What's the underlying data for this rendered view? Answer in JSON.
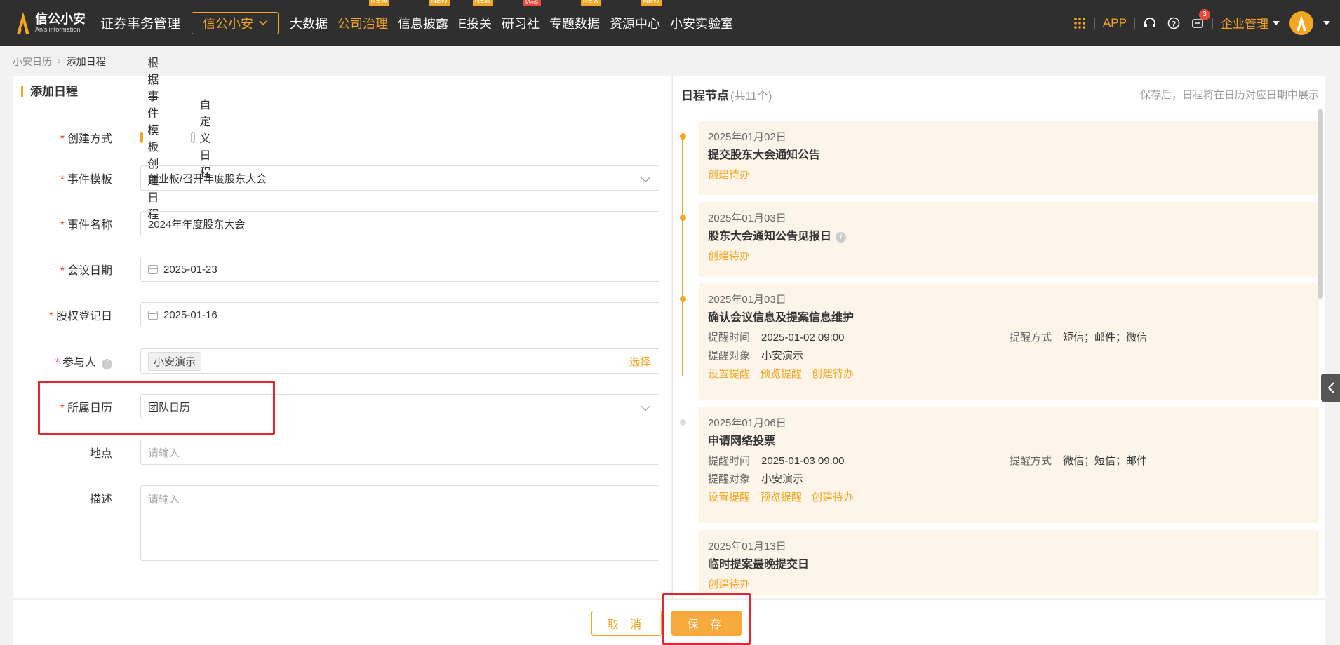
{
  "header": {
    "logo_cn": "信公小安",
    "logo_en": "An's information",
    "system_title": "证券事务管理",
    "brand_select": "信公小安",
    "nav": [
      {
        "label": "大数据",
        "badge": ""
      },
      {
        "label": "公司治理",
        "badge": "NEW"
      },
      {
        "label": "信息披露",
        "badge": "NEW"
      },
      {
        "label": "E投关",
        "badge": "NEW"
      },
      {
        "label": "研习社",
        "badge": "优惠"
      },
      {
        "label": "专题数据",
        "badge": "NEW"
      },
      {
        "label": "资源中心",
        "badge": "NEW"
      },
      {
        "label": "小安实验室",
        "badge": ""
      }
    ],
    "app_label": "APP",
    "message_count": "3",
    "corp_menu": "企业管理"
  },
  "breadcrumb": {
    "parent": "小安日历",
    "current": "添加日程"
  },
  "form": {
    "title": "添加日程",
    "create_mode": {
      "label": "创建方式",
      "options": [
        "根据事件模板创建日程",
        "自定义日程"
      ],
      "selected": "根据事件模板创建日程"
    },
    "template": {
      "label": "事件模板",
      "value": "创业板/召开年度股东大会"
    },
    "event_name": {
      "label": "事件名称",
      "value": "2024年年度股东大会"
    },
    "meeting_date": {
      "label": "会议日期",
      "value": "2025-01-23"
    },
    "record_date": {
      "label": "股权登记日",
      "value": "2025-01-16"
    },
    "participants": {
      "label": "参与人",
      "tag": "小安演示",
      "select_link": "选择"
    },
    "calendar": {
      "label": "所属日历",
      "value": "团队日历"
    },
    "location": {
      "label": "地点",
      "placeholder": "请输入"
    },
    "description": {
      "label": "描述",
      "placeholder": "请输入"
    }
  },
  "schedule": {
    "title": "日程节点",
    "count": "(共11个)",
    "hint": "保存后，日程将在日历对应日期中展示",
    "nodes": [
      {
        "date": "2025年01月02日",
        "name": "提交股东大会通知公告",
        "actions": [
          "创建待办"
        ]
      },
      {
        "date": "2025年01月03日",
        "name": "股东大会通知公告见报日",
        "actions": [
          "创建待办"
        ]
      },
      {
        "date": "2025年01月03日",
        "name": "确认会议信息及提案信息维护",
        "remind_time_label": "提醒时间",
        "remind_time": "2025-01-02 09:00",
        "remind_method_label": "提醒方式",
        "remind_method": "短信；邮件；微信",
        "remind_target_label": "提醒对象",
        "remind_target": "小安演示",
        "actions": [
          "设置提醒",
          "预览提醒",
          "创建待办"
        ]
      },
      {
        "date": "2025年01月06日",
        "name": "申请网络投票",
        "remind_time_label": "提醒时间",
        "remind_time": "2025-01-03 09:00",
        "remind_method_label": "提醒方式",
        "remind_method": "微信；短信；邮件",
        "remind_target_label": "提醒对象",
        "remind_target": "小安演示",
        "actions": [
          "设置提醒",
          "预览提醒",
          "创建待办"
        ]
      },
      {
        "date": "2025年01月13日",
        "name": "临时提案最晚提交日",
        "actions": [
          "创建待办"
        ]
      }
    ]
  },
  "footer": {
    "cancel": "取 消",
    "save": "保 存"
  }
}
